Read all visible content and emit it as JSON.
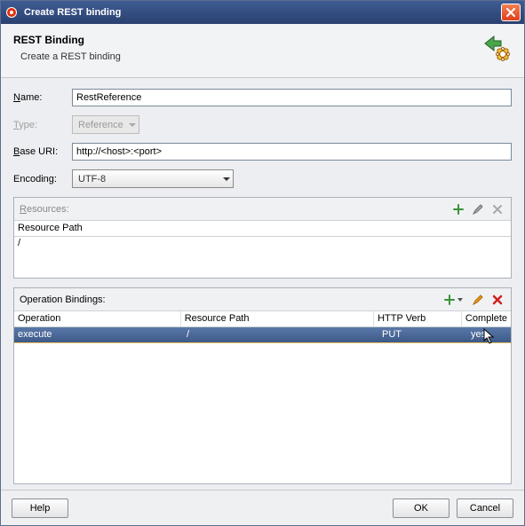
{
  "window": {
    "title": "Create REST binding"
  },
  "header": {
    "title": "REST Binding",
    "subtitle": "Create a REST binding"
  },
  "form": {
    "name_label": "Name:",
    "name_value": "RestReference",
    "type_label": "Type:",
    "type_value": "Reference",
    "baseuri_label_pre": "",
    "baseuri_label": "Base URI:",
    "baseuri_value": "http://<host>:<port>",
    "encoding_label": "Encoding:",
    "encoding_value": "UTF-8"
  },
  "resources": {
    "panel_label": "Resources:",
    "col_path": "Resource Path",
    "rows": [
      {
        "path": "/"
      }
    ]
  },
  "operations": {
    "panel_label": "Operation Bindings:",
    "cols": {
      "operation": "Operation",
      "resource_path": "Resource Path",
      "http_verb": "HTTP Verb",
      "complete": "Complete"
    },
    "rows": [
      {
        "operation": "execute",
        "resource_path": "/",
        "http_verb": "PUT",
        "complete": "yes"
      }
    ]
  },
  "footer": {
    "help": "Help",
    "ok": "OK",
    "cancel": "Cancel"
  }
}
